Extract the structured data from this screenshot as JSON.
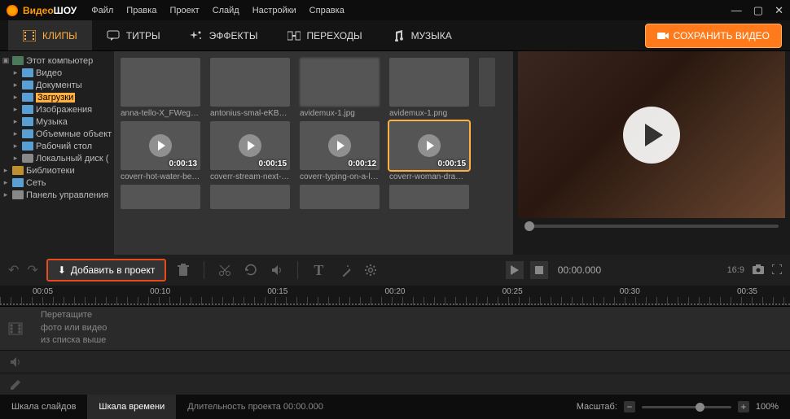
{
  "app": {
    "name1": "Видео",
    "name2": "ШОУ"
  },
  "menu": [
    "Файл",
    "Правка",
    "Проект",
    "Слайд",
    "Настройки",
    "Справка"
  ],
  "tabs": {
    "clips": "КЛИПЫ",
    "titles": "ТИТРЫ",
    "effects": "ЭФФЕКТЫ",
    "transitions": "ПЕРЕХОДЫ",
    "music": "МУЗЫКА"
  },
  "save_button": "СОХРАНИТЬ ВИДЕО",
  "tree": {
    "computer": "Этот компьютер",
    "video": "Видео",
    "documents": "Документы",
    "downloads": "Загрузки",
    "pictures": "Изображения",
    "music": "Музыка",
    "objects3d": "Объемные объект",
    "desktop": "Рабочий стол",
    "disk": "Локальный диск (",
    "libraries": "Библиотеки",
    "network": "Сеть",
    "panel": "Панель управления"
  },
  "thumbs": {
    "r1": [
      {
        "cap": "anna-tello-X_FWega1EU0-..."
      },
      {
        "cap": "antonius-smal-eKB0NmIUe..."
      },
      {
        "cap": "avidemux-1.jpg"
      },
      {
        "cap": "avidemux-1.png"
      }
    ],
    "r2": [
      {
        "cap": "coverr-hot-water-being-p...",
        "dur": "0:00:13"
      },
      {
        "cap": "coverr-stream-next-to-the...",
        "dur": "0:00:15"
      },
      {
        "cap": "coverr-typing-on-a-laptop...",
        "dur": "0:00:12"
      },
      {
        "cap": "coverr-woman-drawing-in-...",
        "dur": "0:00:15"
      }
    ]
  },
  "add_button": "Добавить в проект",
  "playback": {
    "time": "00:00.000",
    "aspect": "16:9"
  },
  "ruler": [
    "00:05",
    "00:10",
    "00:15",
    "00:20",
    "00:25",
    "00:30",
    "00:35"
  ],
  "placeholder": {
    "l1": "Перетащите",
    "l2": "фото или видео",
    "l3": "из списка выше"
  },
  "status": {
    "slides": "Шкала слайдов",
    "timeline": "Шкала времени",
    "duration": "Длительность проекта 00:00.000",
    "scale_label": "Масштаб:",
    "scale_value": "100%"
  }
}
